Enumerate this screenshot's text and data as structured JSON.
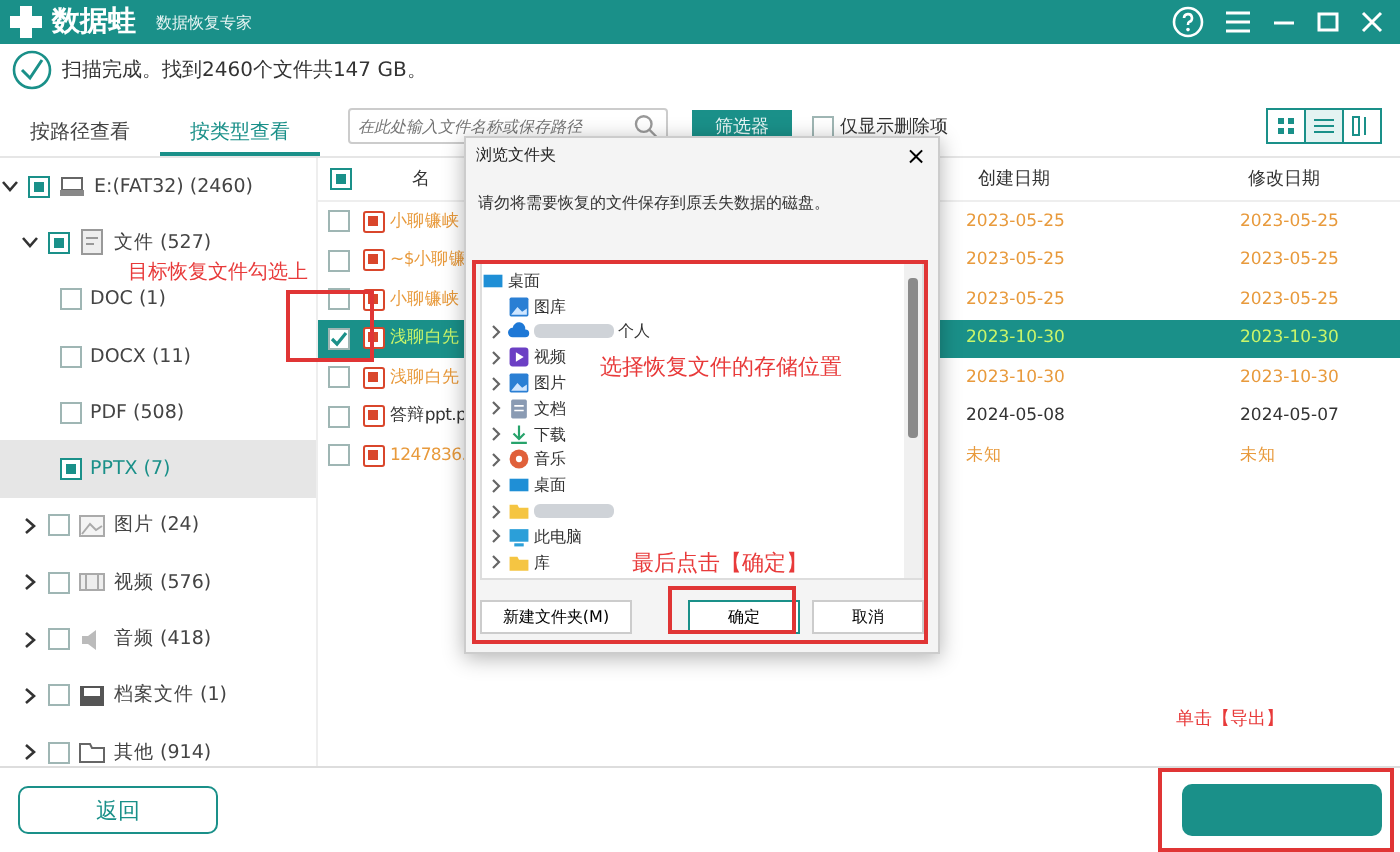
{
  "app": {
    "name": "数据蛙",
    "subtitle": "数据恢复专家"
  },
  "status": "扫描完成。找到2460个文件共147 GB。",
  "view_tabs": [
    {
      "label": "按路径查看",
      "selected": false
    },
    {
      "label": "按类型查看",
      "selected": true
    }
  ],
  "search": {
    "placeholder": "在此处输入文件名称或保存路径"
  },
  "filter_button": "筛选器",
  "deleted_only": {
    "label": "仅显示删除项",
    "checked": false
  },
  "view_modes": [
    {
      "kind": "grid",
      "selected": false
    },
    {
      "kind": "list",
      "selected": true
    },
    {
      "kind": "detail",
      "selected": false
    }
  ],
  "tree": [
    {
      "label": "E:(FAT32) (2460)",
      "checked": true,
      "expanded": true,
      "selected": false,
      "children": [
        {
          "label": "文件 (527)",
          "checked": true,
          "expanded": true,
          "selected": false,
          "children": [
            {
              "label": "DOC (1)",
              "checked": false,
              "selected": false
            },
            {
              "label": "DOCX (11)",
              "checked": false,
              "selected": false
            },
            {
              "label": "PDF (508)",
              "checked": false,
              "selected": false
            },
            {
              "label": "PPTX (7)",
              "checked": true,
              "selected": true
            }
          ]
        },
        {
          "label": "图片 (24)",
          "checked": false,
          "expanded": false,
          "selected": false
        },
        {
          "label": "视频 (576)",
          "checked": false,
          "expanded": false,
          "selected": false
        },
        {
          "label": "音频 (418)",
          "checked": false,
          "expanded": false,
          "selected": false
        },
        {
          "label": "档案文件 (1)",
          "checked": false,
          "expanded": false,
          "selected": false
        },
        {
          "label": "其他 (914)",
          "checked": false,
          "expanded": false,
          "selected": false
        }
      ]
    }
  ],
  "table": {
    "select_all": true,
    "columns": [
      "名",
      "创建日期",
      "修改日期"
    ],
    "rows": [
      {
        "name": "小聊镰峡",
        "created": "2023-05-25",
        "modified": "2023-05-25",
        "deleted": true,
        "checked": false,
        "selected": false
      },
      {
        "name": "~$小聊镰",
        "created": "2023-05-25",
        "modified": "2023-05-25",
        "deleted": true,
        "checked": false,
        "selected": false
      },
      {
        "name": "小聊镰峡",
        "created": "2023-05-25",
        "modified": "2023-05-25",
        "deleted": true,
        "checked": false,
        "selected": false
      },
      {
        "name": "浅聊白先",
        "created": "2023-10-30",
        "modified": "2023-10-30",
        "deleted": true,
        "checked": true,
        "selected": true
      },
      {
        "name": "浅聊白先",
        "created": "2023-10-30",
        "modified": "2023-10-30",
        "deleted": true,
        "checked": false,
        "selected": false
      },
      {
        "name": "答辩ppt.p",
        "created": "2024-05-08",
        "modified": "2024-05-07",
        "deleted": false,
        "checked": false,
        "selected": false
      },
      {
        "name": "1247836.",
        "created": "未知",
        "modified": "未知",
        "deleted": true,
        "checked": false,
        "selected": false
      }
    ]
  },
  "back_button": "返回",
  "dialog": {
    "title": "浏览文件夹",
    "close": "×",
    "message": "请勿将需要恢复的文件保存到原丢失数据的磁盘。",
    "folders": [
      {
        "label": "桌面",
        "expander": false,
        "redacted": false
      },
      {
        "label": "图库",
        "expander": false,
        "redacted": false
      },
      {
        "label": "个人",
        "expander": true,
        "redacted": true
      },
      {
        "label": "视频",
        "expander": true,
        "redacted": false
      },
      {
        "label": "图片",
        "expander": true,
        "redacted": false
      },
      {
        "label": "文档",
        "expander": true,
        "redacted": false
      },
      {
        "label": "下载",
        "expander": true,
        "redacted": false
      },
      {
        "label": "音乐",
        "expander": true,
        "redacted": false
      },
      {
        "label": "桌面",
        "expander": true,
        "redacted": false
      },
      {
        "expander": true,
        "redacted": true
      },
      {
        "label": "此电脑",
        "expander": true,
        "redacted": false
      },
      {
        "label": "库",
        "expander": true,
        "redacted": false
      }
    ],
    "buttons": [
      {
        "label": "新建文件夹(M)",
        "default": false
      },
      {
        "label": "确定",
        "default": true
      },
      {
        "label": "取消",
        "default": false
      }
    ]
  },
  "annotations": [
    "目标恢复文件勾选上",
    "选择恢复文件的存储位置",
    "最后点击【确定】",
    "单击【导出】"
  ]
}
